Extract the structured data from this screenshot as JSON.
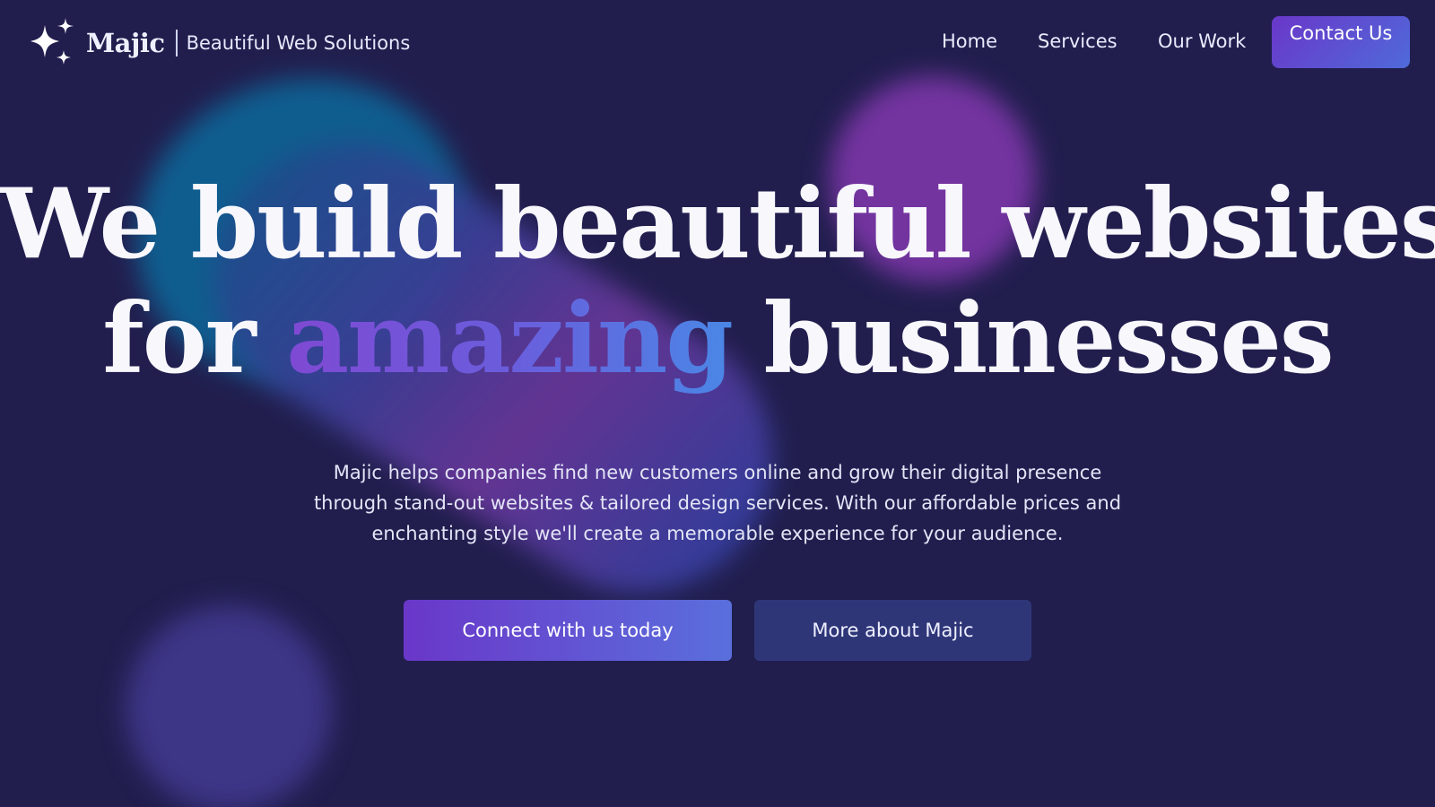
{
  "header": {
    "brand": "Majic",
    "tagline": "Beautiful Web Solutions",
    "logo_icon": "sparkles-icon",
    "nav": {
      "home": "Home",
      "services": "Services",
      "our_work": "Our Work",
      "contact": "Contact Us"
    }
  },
  "hero": {
    "title_line1": "We build beautiful websites",
    "title_line2_prefix": "for ",
    "title_accent": "amazing",
    "title_line2_suffix": " businesses",
    "subtitle": "Majic helps companies find new customers online and grow their digital presence through stand-out websites & tailored design services. With our affordable prices and enchanting style we'll create a memorable experience for your audience.",
    "cta_primary": "Connect with us today",
    "cta_secondary": "More about Majic"
  },
  "colors": {
    "background": "#211e4e",
    "accent_start": "#6a37c9",
    "accent_end": "#4f6ad9",
    "secondary_button": "#2f3678"
  }
}
